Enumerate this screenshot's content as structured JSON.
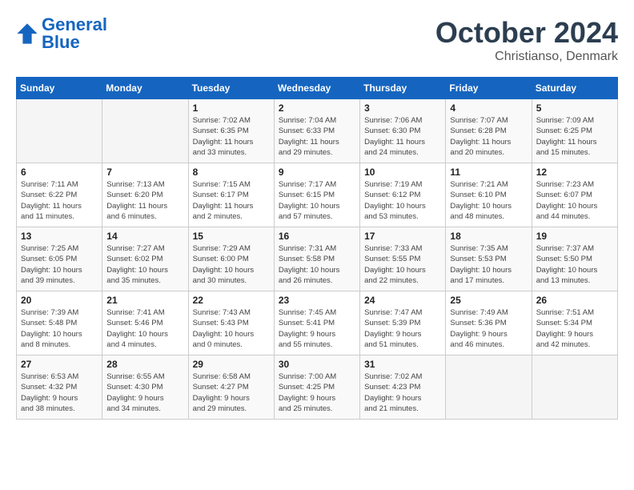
{
  "header": {
    "logo_general": "General",
    "logo_blue": "Blue",
    "month": "October 2024",
    "location": "Christianso, Denmark"
  },
  "days_of_week": [
    "Sunday",
    "Monday",
    "Tuesday",
    "Wednesday",
    "Thursday",
    "Friday",
    "Saturday"
  ],
  "weeks": [
    [
      {
        "day": "",
        "info": ""
      },
      {
        "day": "",
        "info": ""
      },
      {
        "day": "1",
        "info": "Sunrise: 7:02 AM\nSunset: 6:35 PM\nDaylight: 11 hours\nand 33 minutes."
      },
      {
        "day": "2",
        "info": "Sunrise: 7:04 AM\nSunset: 6:33 PM\nDaylight: 11 hours\nand 29 minutes."
      },
      {
        "day": "3",
        "info": "Sunrise: 7:06 AM\nSunset: 6:30 PM\nDaylight: 11 hours\nand 24 minutes."
      },
      {
        "day": "4",
        "info": "Sunrise: 7:07 AM\nSunset: 6:28 PM\nDaylight: 11 hours\nand 20 minutes."
      },
      {
        "day": "5",
        "info": "Sunrise: 7:09 AM\nSunset: 6:25 PM\nDaylight: 11 hours\nand 15 minutes."
      }
    ],
    [
      {
        "day": "6",
        "info": "Sunrise: 7:11 AM\nSunset: 6:22 PM\nDaylight: 11 hours\nand 11 minutes."
      },
      {
        "day": "7",
        "info": "Sunrise: 7:13 AM\nSunset: 6:20 PM\nDaylight: 11 hours\nand 6 minutes."
      },
      {
        "day": "8",
        "info": "Sunrise: 7:15 AM\nSunset: 6:17 PM\nDaylight: 11 hours\nand 2 minutes."
      },
      {
        "day": "9",
        "info": "Sunrise: 7:17 AM\nSunset: 6:15 PM\nDaylight: 10 hours\nand 57 minutes."
      },
      {
        "day": "10",
        "info": "Sunrise: 7:19 AM\nSunset: 6:12 PM\nDaylight: 10 hours\nand 53 minutes."
      },
      {
        "day": "11",
        "info": "Sunrise: 7:21 AM\nSunset: 6:10 PM\nDaylight: 10 hours\nand 48 minutes."
      },
      {
        "day": "12",
        "info": "Sunrise: 7:23 AM\nSunset: 6:07 PM\nDaylight: 10 hours\nand 44 minutes."
      }
    ],
    [
      {
        "day": "13",
        "info": "Sunrise: 7:25 AM\nSunset: 6:05 PM\nDaylight: 10 hours\nand 39 minutes."
      },
      {
        "day": "14",
        "info": "Sunrise: 7:27 AM\nSunset: 6:02 PM\nDaylight: 10 hours\nand 35 minutes."
      },
      {
        "day": "15",
        "info": "Sunrise: 7:29 AM\nSunset: 6:00 PM\nDaylight: 10 hours\nand 30 minutes."
      },
      {
        "day": "16",
        "info": "Sunrise: 7:31 AM\nSunset: 5:58 PM\nDaylight: 10 hours\nand 26 minutes."
      },
      {
        "day": "17",
        "info": "Sunrise: 7:33 AM\nSunset: 5:55 PM\nDaylight: 10 hours\nand 22 minutes."
      },
      {
        "day": "18",
        "info": "Sunrise: 7:35 AM\nSunset: 5:53 PM\nDaylight: 10 hours\nand 17 minutes."
      },
      {
        "day": "19",
        "info": "Sunrise: 7:37 AM\nSunset: 5:50 PM\nDaylight: 10 hours\nand 13 minutes."
      }
    ],
    [
      {
        "day": "20",
        "info": "Sunrise: 7:39 AM\nSunset: 5:48 PM\nDaylight: 10 hours\nand 8 minutes."
      },
      {
        "day": "21",
        "info": "Sunrise: 7:41 AM\nSunset: 5:46 PM\nDaylight: 10 hours\nand 4 minutes."
      },
      {
        "day": "22",
        "info": "Sunrise: 7:43 AM\nSunset: 5:43 PM\nDaylight: 10 hours\nand 0 minutes."
      },
      {
        "day": "23",
        "info": "Sunrise: 7:45 AM\nSunset: 5:41 PM\nDaylight: 9 hours\nand 55 minutes."
      },
      {
        "day": "24",
        "info": "Sunrise: 7:47 AM\nSunset: 5:39 PM\nDaylight: 9 hours\nand 51 minutes."
      },
      {
        "day": "25",
        "info": "Sunrise: 7:49 AM\nSunset: 5:36 PM\nDaylight: 9 hours\nand 46 minutes."
      },
      {
        "day": "26",
        "info": "Sunrise: 7:51 AM\nSunset: 5:34 PM\nDaylight: 9 hours\nand 42 minutes."
      }
    ],
    [
      {
        "day": "27",
        "info": "Sunrise: 6:53 AM\nSunset: 4:32 PM\nDaylight: 9 hours\nand 38 minutes."
      },
      {
        "day": "28",
        "info": "Sunrise: 6:55 AM\nSunset: 4:30 PM\nDaylight: 9 hours\nand 34 minutes."
      },
      {
        "day": "29",
        "info": "Sunrise: 6:58 AM\nSunset: 4:27 PM\nDaylight: 9 hours\nand 29 minutes."
      },
      {
        "day": "30",
        "info": "Sunrise: 7:00 AM\nSunset: 4:25 PM\nDaylight: 9 hours\nand 25 minutes."
      },
      {
        "day": "31",
        "info": "Sunrise: 7:02 AM\nSunset: 4:23 PM\nDaylight: 9 hours\nand 21 minutes."
      },
      {
        "day": "",
        "info": ""
      },
      {
        "day": "",
        "info": ""
      }
    ]
  ]
}
